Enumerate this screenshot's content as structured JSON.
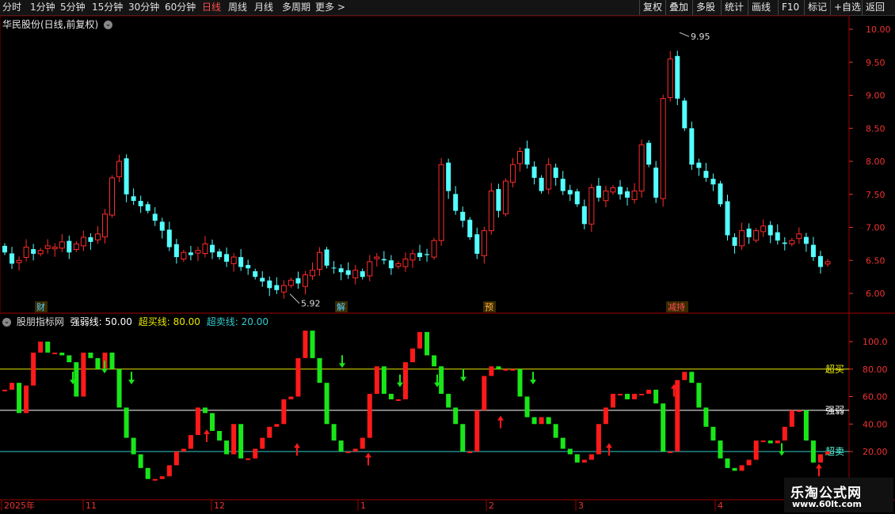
{
  "toolbar": {
    "left": [
      "分时",
      "1分钟",
      "5分钟",
      "15分钟",
      "30分钟",
      "60分钟",
      "日线",
      "周线",
      "月线",
      "多周期",
      "更多 >"
    ],
    "active": "日线",
    "right": [
      "复权",
      "叠加",
      "多股",
      "统计",
      "画线",
      "F10",
      "标记",
      "+自选",
      "返回"
    ]
  },
  "stock_title": "华民股份(日线,前复权)",
  "price_axis": [
    "10.00",
    "9.50",
    "9.00",
    "8.50",
    "8.00",
    "7.50",
    "7.00",
    "6.50",
    "6.00"
  ],
  "price_high_label": "9.95",
  "price_low_label": "5.92",
  "event_tags": [
    {
      "text": "财",
      "color": "#4fd3ff"
    },
    {
      "text": "解",
      "color": "#4fd3ff"
    },
    {
      "text": "预",
      "color": "#ffb040"
    },
    {
      "text": "减持",
      "color": "#ff5050"
    }
  ],
  "indicator": {
    "name": "股朋指标网",
    "strong_label": "强弱线: 50.00",
    "overbuy_label": "超买线: 80.00",
    "oversell_label": "超卖线: 20.00",
    "axis": [
      "100.0",
      "80.00",
      "60.00",
      "40.00",
      "20.00"
    ],
    "line_tags": {
      "overbuy": "超买",
      "strong": "强弱",
      "oversell": "超卖"
    }
  },
  "time_axis": [
    "2025年",
    "11",
    "12",
    "1",
    "2",
    "3",
    "4"
  ],
  "watermark": {
    "line1": "乐淘公式网",
    "line2": "www.60lt.com"
  },
  "colors": {
    "up": "#ff2b2b",
    "down": "#54ffff",
    "ind_up": "#ff1a1a",
    "ind_down": "#19e619",
    "overbuy": "#e8e800",
    "strong": "#ffffff",
    "oversell": "#33cccc"
  },
  "chart_data": [
    {
      "type": "candlestick",
      "title": "华民股份(日线,前复权)",
      "ylim": [
        5.8,
        10.1
      ],
      "annotations": [
        {
          "label": "9.95",
          "value": 9.95
        },
        {
          "label": "5.92",
          "value": 5.92
        }
      ]
    },
    {
      "type": "bar",
      "title": "股朋指标网",
      "ylim": [
        0,
        110
      ],
      "reference_lines": [
        {
          "name": "强弱线",
          "value": 50
        },
        {
          "name": "超买线",
          "value": 80
        },
        {
          "name": "超卖线",
          "value": 20
        }
      ]
    }
  ]
}
